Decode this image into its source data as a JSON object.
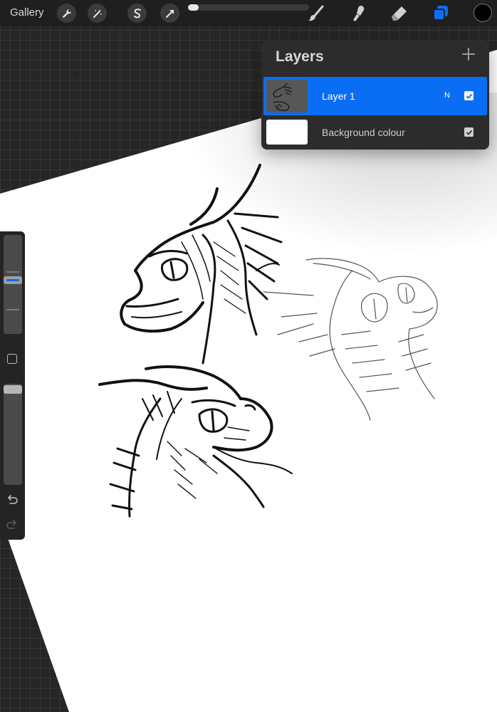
{
  "topbar": {
    "gallery_label": "Gallery",
    "left_tools": [
      "wrench-icon",
      "magic-wand-icon",
      "selection-s-icon",
      "arrow-transform-icon"
    ],
    "right_tools": [
      "brush-icon",
      "smudge-icon",
      "eraser-icon",
      "layers-icon"
    ],
    "progress_percent": 9,
    "current_color": "#000000",
    "accent_color": "#0a6ef5"
  },
  "layers": {
    "title": "Layers",
    "add_icon": "plus-icon",
    "items": [
      {
        "name": "Layer 1",
        "blend_mode": "N",
        "visible": true,
        "selected": true
      },
      {
        "name": "Background colour",
        "visible": true,
        "selected": false
      }
    ]
  },
  "sidebar": {
    "size_level": 0.55,
    "opacity_level": 1.0,
    "modify_icon": "square-modify-icon",
    "undo_icon": "undo-icon",
    "redo_icon": "redo-icon"
  }
}
